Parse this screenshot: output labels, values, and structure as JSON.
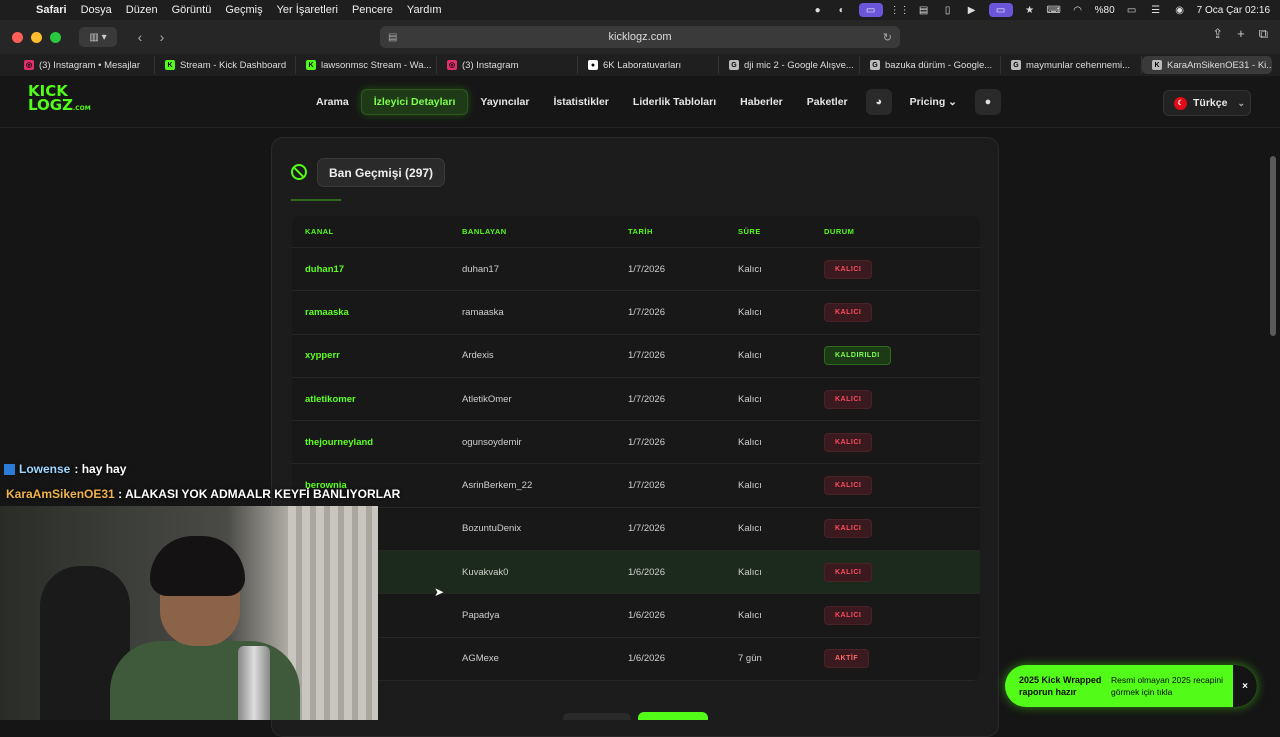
{
  "menubar": {
    "items": [
      "Safari",
      "Dosya",
      "Düzen",
      "Görüntü",
      "Geçmiş",
      "Yer İşaretleri",
      "Pencere",
      "Yardım"
    ],
    "battery": "%80",
    "datetime": "7 Oca Çar  02:16"
  },
  "browser": {
    "url": "kicklogz.com",
    "tabs": [
      {
        "label": "(3) Instagram • Mesajlar",
        "fav_color": "#e1306c",
        "fav": "◎"
      },
      {
        "label": "Stream - Kick Dashboard",
        "fav_color": "#53fc18",
        "fav": "K"
      },
      {
        "label": "lawsonmsc Stream - Wa...",
        "fav_color": "#53fc18",
        "fav": "K"
      },
      {
        "label": "(3) Instagram",
        "fav_color": "#e1306c",
        "fav": "◎"
      },
      {
        "label": "6K Laboratuvarları",
        "fav_color": "#ffffff",
        "fav": "●"
      },
      {
        "label": "dji mic 2 - Google Alışve...",
        "fav_color": "#bbbbbb",
        "fav": "G"
      },
      {
        "label": "bazuka dürüm - Google...",
        "fav_color": "#bbbbbb",
        "fav": "G"
      },
      {
        "label": "maymunlar cehennemi...",
        "fav_color": "#bbbbbb",
        "fav": "G"
      },
      {
        "label": "KaraAmSikenOE31 - Ki...",
        "fav_color": "#bbbbbb",
        "fav": "K"
      }
    ]
  },
  "site": {
    "logo_line1": "KICK",
    "logo_line2": "LOGZ",
    "logo_com": ".COM",
    "nav": [
      {
        "label": "Arama",
        "active": false
      },
      {
        "label": "İzleyici Detayları",
        "active": true
      },
      {
        "label": "Yayıncılar",
        "active": false
      },
      {
        "label": "İstatistikler",
        "active": false
      },
      {
        "label": "Liderlik Tabloları",
        "active": false
      },
      {
        "label": "Haberler",
        "active": false
      },
      {
        "label": "Paketler",
        "active": false
      }
    ],
    "pricing": "Pricing",
    "language": "Türkçe"
  },
  "ban_history": {
    "title": "Ban Geçmişi (297)",
    "columns": [
      "KANAL",
      "BANLAYAN",
      "TARİH",
      "SÜRE",
      "DURUM"
    ],
    "rows": [
      {
        "kanal": "duhan17",
        "banlayan": "duhan17",
        "tarih": "1/7/2026",
        "sure": "Kalıcı",
        "durum": "KALICI",
        "type": "kalici"
      },
      {
        "kanal": "ramaaska",
        "banlayan": "ramaaska",
        "tarih": "1/7/2026",
        "sure": "Kalıcı",
        "durum": "KALICI",
        "type": "kalici"
      },
      {
        "kanal": "xypperr",
        "banlayan": "Ardexis",
        "tarih": "1/7/2026",
        "sure": "Kalıcı",
        "durum": "KALDIRILDI",
        "type": "kaldirildi"
      },
      {
        "kanal": "atletikomer",
        "banlayan": "AtletikOmer",
        "tarih": "1/7/2026",
        "sure": "Kalıcı",
        "durum": "KALICI",
        "type": "kalici"
      },
      {
        "kanal": "thejourneyland",
        "banlayan": "ogunsoydemir",
        "tarih": "1/7/2026",
        "sure": "Kalıcı",
        "durum": "KALICI",
        "type": "kalici"
      },
      {
        "kanal": "berownia",
        "banlayan": "AsrinBerkem_22",
        "tarih": "1/7/2026",
        "sure": "Kalıcı",
        "durum": "KALICI",
        "type": "kalici"
      },
      {
        "kanal": "",
        "banlayan": "BozuntuDenix",
        "tarih": "1/7/2026",
        "sure": "Kalıcı",
        "durum": "KALICI",
        "type": "kalici"
      },
      {
        "kanal": "",
        "banlayan": "Kuvakvak0",
        "tarih": "1/6/2026",
        "sure": "Kalıcı",
        "durum": "KALICI",
        "type": "kalici"
      },
      {
        "kanal": "",
        "banlayan": "Papadya",
        "tarih": "1/6/2026",
        "sure": "Kalıcı",
        "durum": "KALICI",
        "type": "kalici"
      },
      {
        "kanal": "",
        "banlayan": "AGMexe",
        "tarih": "1/6/2026",
        "sure": "7 gün",
        "durum": "AKTİF",
        "type": "aktif"
      }
    ]
  },
  "overlay": {
    "chat": [
      {
        "user": "Lowense",
        "message": ": hay hay"
      },
      {
        "user": "KaraAmSikenOE31",
        "message": ": ALAKASI YOK ADMAALR KEYFİ BANLIYORLAR"
      }
    ]
  },
  "toast": {
    "title": "2025 Kick Wrapped raporun hazır",
    "body": "Resmi olmayan 2025 recapini görmek için tıkla",
    "close": "×"
  },
  "colors": {
    "accent": "#53fc18",
    "danger": "#ff4d5e"
  }
}
